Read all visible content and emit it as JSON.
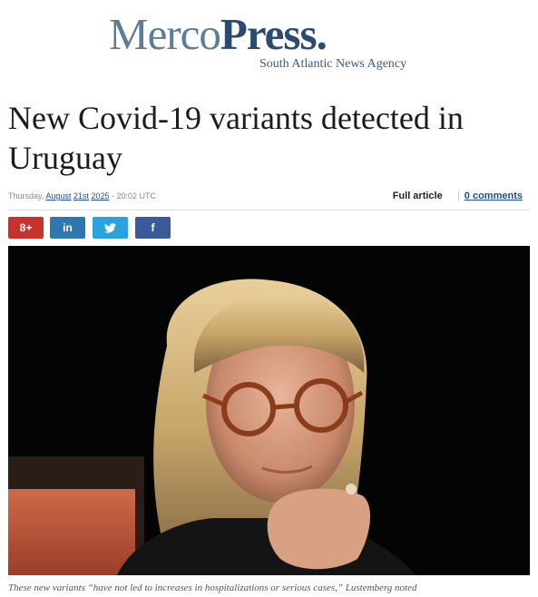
{
  "logo": {
    "merco": "Merco",
    "press": "Press.",
    "tagline": "South Atlantic News Agency"
  },
  "article": {
    "headline": "New Covid-19 variants detected in Uruguay",
    "date": {
      "weekday": "Thursday,",
      "month": "August",
      "day": "21st",
      "year": "2025",
      "time": "- 20:02 UTC"
    },
    "full_article_label": "Full article",
    "comments_label": "0 comments",
    "photo_caption": "These new variants “have not led to increases in hospitalizations or serious cases,” Lustemberg noted"
  },
  "share": {
    "google_plus": "8+",
    "linkedin": "in",
    "twitter": "🐦",
    "facebook": "f"
  },
  "colors": {
    "logo_light": "#5e7c9a",
    "logo_dark": "#2a4a6e",
    "link": "#1f4f8f",
    "google_plus": "#c8322a",
    "linkedin": "#2f77b0",
    "twitter": "#2aa3dc",
    "facebook": "#3a5a99"
  }
}
